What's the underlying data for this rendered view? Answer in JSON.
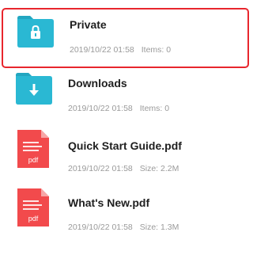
{
  "colors": {
    "folder": "#2ab8d3",
    "folder_tab": "#23a6c0",
    "pdf": "#f24a4c",
    "pdf_fold": "#f7a6a6",
    "selection_border": "#e8262d"
  },
  "files": [
    {
      "name": "Private",
      "date": "2019/10/22 01:58",
      "detail": "Items: 0",
      "icon": "lock-folder-icon",
      "selected": true
    },
    {
      "name": "Downloads",
      "date": "2019/10/22 01:58",
      "detail": "Items: 0",
      "icon": "download-folder-icon",
      "selected": false
    },
    {
      "name": "Quick Start Guide.pdf",
      "date": "2019/10/22 01:58",
      "detail": "Size: 2.2M",
      "icon": "pdf-file-icon",
      "icon_label": "pdf",
      "selected": false
    },
    {
      "name": "What's New.pdf",
      "date": "2019/10/22 01:58",
      "detail": "Size: 1.3M",
      "icon": "pdf-file-icon",
      "icon_label": "pdf",
      "selected": false
    }
  ]
}
